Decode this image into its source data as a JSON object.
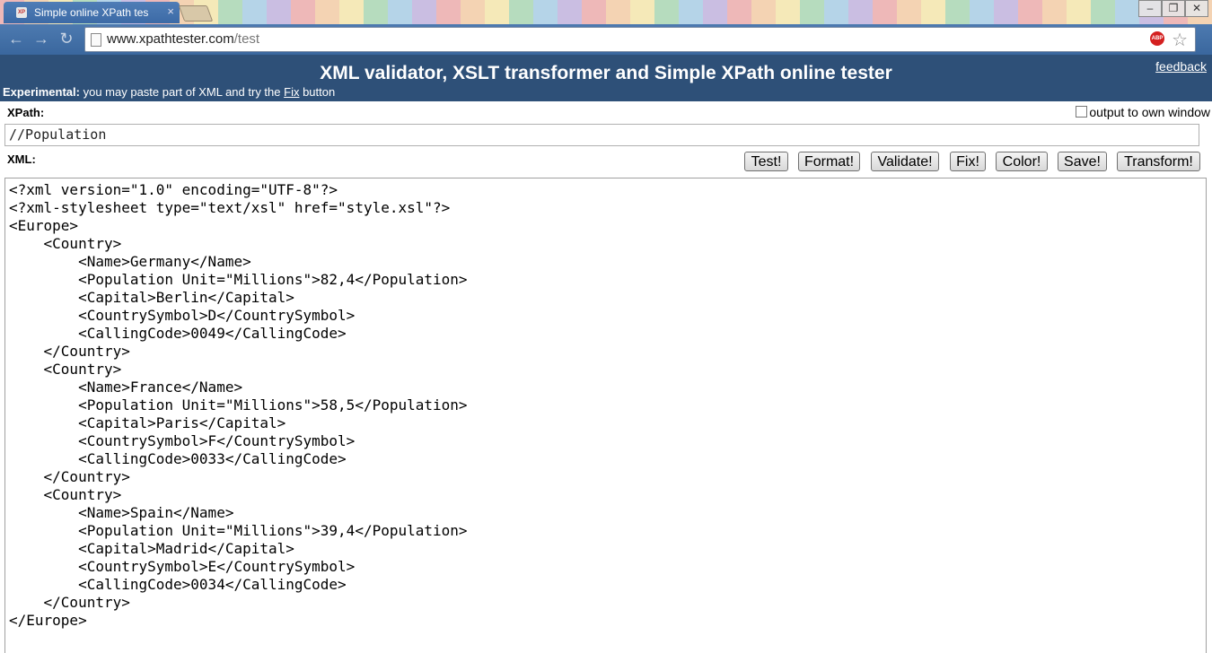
{
  "browser": {
    "tab_title": "Simple online XPath tes",
    "favicon_text": "XP",
    "url_host": "www.xpathtester.com",
    "url_path": "/test",
    "extension_badge": "ABP"
  },
  "header": {
    "title": "XML validator, XSLT transformer and Simple XPath online tester",
    "feedback_label": "feedback",
    "experimental_bold": "Experimental:",
    "experimental_text": " you may paste part of XML and try the ",
    "fix_link": "Fix",
    "experimental_tail": " button"
  },
  "form": {
    "xpath_label": "XPath:",
    "own_window_label": "output to own window",
    "xpath_value": "//Population",
    "xml_label": "XML:"
  },
  "buttons": {
    "test": "Test!",
    "format": "Format!",
    "validate": "Validate!",
    "fix": "Fix!",
    "color": "Color!",
    "save": "Save!",
    "transform": "Transform!"
  },
  "xml_lines": [
    "<?xml version=\"1.0\" encoding=\"UTF-8\"?>",
    "<?xml-stylesheet type=\"text/xsl\" href=\"style.xsl\"?>",
    "<Europe>",
    "    <Country>",
    "        <Name>Germany</Name>",
    "        <Population Unit=\"Millions\">82,4</Population>",
    "        <Capital>Berlin</Capital>",
    "        <CountrySymbol>D</CountrySymbol>",
    "        <CallingCode>0049</CallingCode>",
    "    </Country>",
    "    <Country>",
    "        <Name>France</Name>",
    "        <Population Unit=\"Millions\">58,5</Population>",
    "        <Capital>Paris</Capital>",
    "        <CountrySymbol>F</CountrySymbol>",
    "        <CallingCode>0033</CallingCode>",
    "    </Country>",
    "    <Country>",
    "        <Name>Spain</Name>",
    "        <Population Unit=\"Millions\">39,4</Population>",
    "        <Capital>Madrid</Capital>",
    "        <CountrySymbol>E</CountrySymbol>",
    "        <CallingCode>0034</CallingCode>",
    "    </Country>",
    "</Europe>"
  ]
}
